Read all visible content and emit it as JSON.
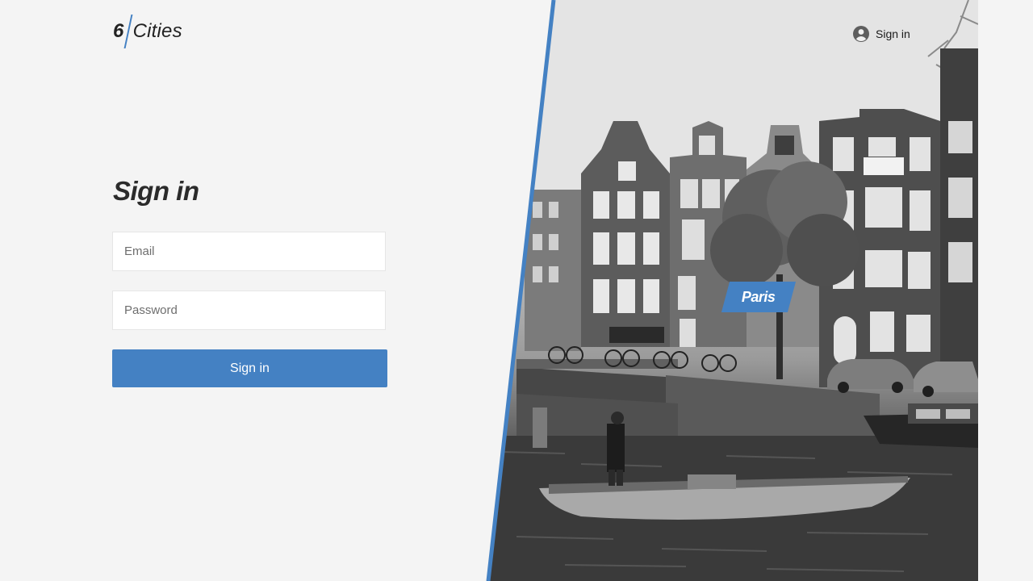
{
  "header": {
    "logo": {
      "number": "6",
      "word": "Cities"
    },
    "user_nav": {
      "label": "Sign in",
      "icon": "user-avatar-icon"
    }
  },
  "login": {
    "title": "Sign in",
    "email": {
      "placeholder": "Email",
      "value": ""
    },
    "password": {
      "placeholder": "Password",
      "value": ""
    },
    "submit_label": "Sign in"
  },
  "location": {
    "city": "Paris"
  },
  "colors": {
    "accent": "#4481c3",
    "background": "#f4f4f4",
    "text": "#2b2b2b"
  }
}
